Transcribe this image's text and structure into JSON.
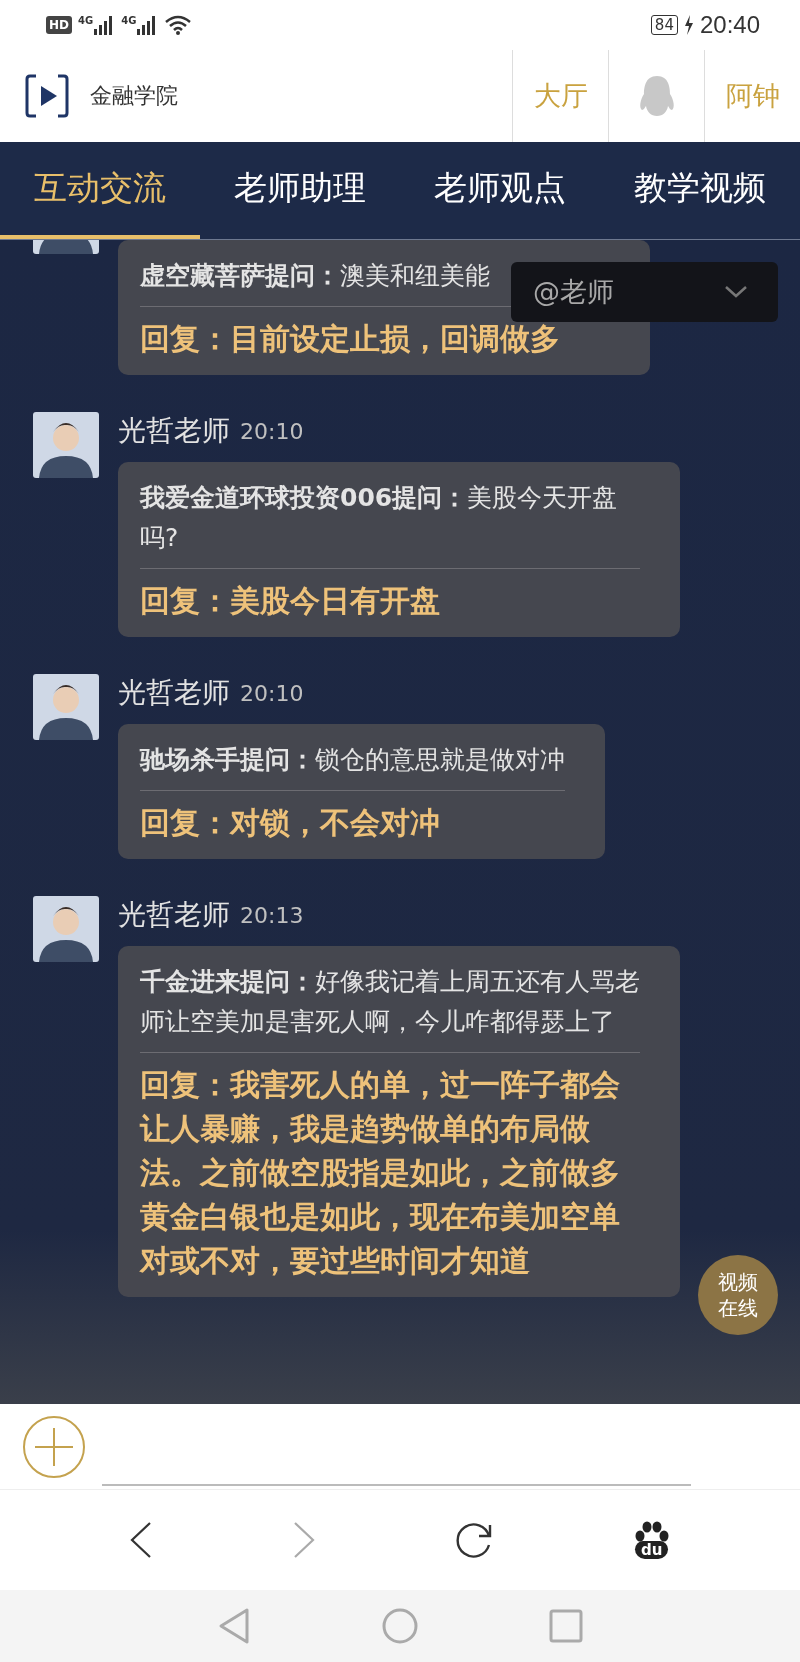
{
  "status_bar": {
    "badge": "HD",
    "networks": [
      "4G",
      "4G"
    ],
    "battery": "84",
    "time": "20:40"
  },
  "header": {
    "title": "金融学院",
    "hall_link": "大厅",
    "user_name": "阿钟"
  },
  "tabs": [
    {
      "label": "互动交流",
      "selected": true
    },
    {
      "label": "老师助理",
      "selected": false
    },
    {
      "label": "老师观点",
      "selected": false
    },
    {
      "label": "教学视频",
      "selected": false
    }
  ],
  "mention_dropdown": {
    "value": "@老师"
  },
  "messages": [
    {
      "question": "**虚空藏菩萨提问：**澳美和纽美能",
      "reply": "回复：目前设定止损，回调做多"
    },
    {
      "author": "光哲老师",
      "time": "20:10",
      "question": "**我爱金道环球投资006提问：**美股今天开盘吗?",
      "reply": "回复：美股今日有开盘"
    },
    {
      "author": "光哲老师",
      "time": "20:10",
      "question": "**驰场杀手提问：**锁仓的意思就是做对冲",
      "reply": "回复：对锁，不会对冲"
    },
    {
      "author": "光哲老师",
      "time": "20:13",
      "question": "**千金进来提问：**好像我记着上周五还有人骂老师让空美加是害死人啊，今儿咋都得瑟上了",
      "reply": "回复：我害死人的单，过一阵子都会让人暴赚，我是趋势做单的布局做法。之前做空股指是如此，之前做多黄金白银也是如此，现在布美加空单对或不对，要过些时间才知道"
    }
  ],
  "video_badge": {
    "label": "视频在线"
  },
  "browser_bar": {
    "logo_text": "du"
  }
}
